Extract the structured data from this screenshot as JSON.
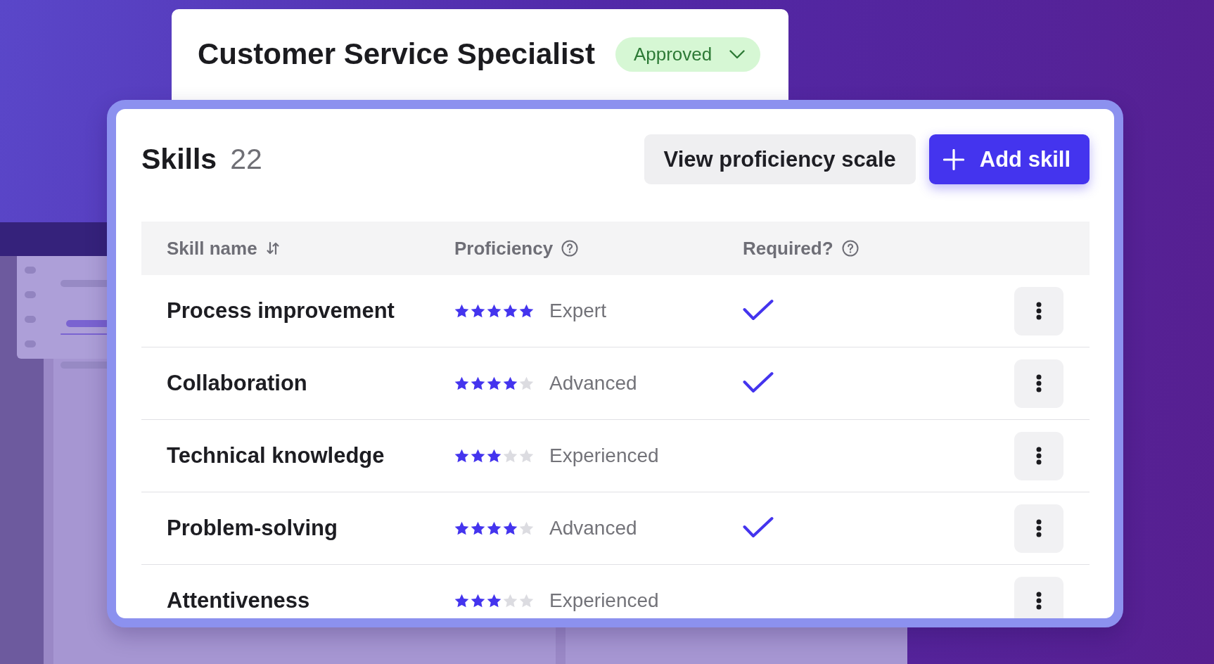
{
  "job": {
    "title": "Customer Service Specialist",
    "status": {
      "label": "Approved"
    }
  },
  "skills": {
    "title": "Skills",
    "count": "22",
    "actions": [
      {
        "kind": "secondary",
        "label": "View proficiency scale"
      },
      {
        "kind": "primary",
        "label": "Add skill"
      }
    ],
    "table": {
      "columns": [
        {
          "label": "Skill name",
          "kind": "sortable"
        },
        {
          "label": "Proficiency",
          "kind": "help"
        },
        {
          "label": "Required?",
          "kind": "help"
        }
      ],
      "rows": [
        {
          "name": "Process improvement",
          "stars": 5,
          "proficiency": "Expert",
          "required": true
        },
        {
          "name": "Collaboration",
          "stars": 4,
          "proficiency": "Advanced",
          "required": true
        },
        {
          "name": "Technical knowledge",
          "stars": 3,
          "proficiency": "Experienced",
          "required": false
        },
        {
          "name": "Problem-solving",
          "stars": 4,
          "proficiency": "Advanced",
          "required": true
        },
        {
          "name": "Attentiveness",
          "stars": 3,
          "proficiency": "Experienced",
          "required": false
        }
      ]
    }
  }
}
